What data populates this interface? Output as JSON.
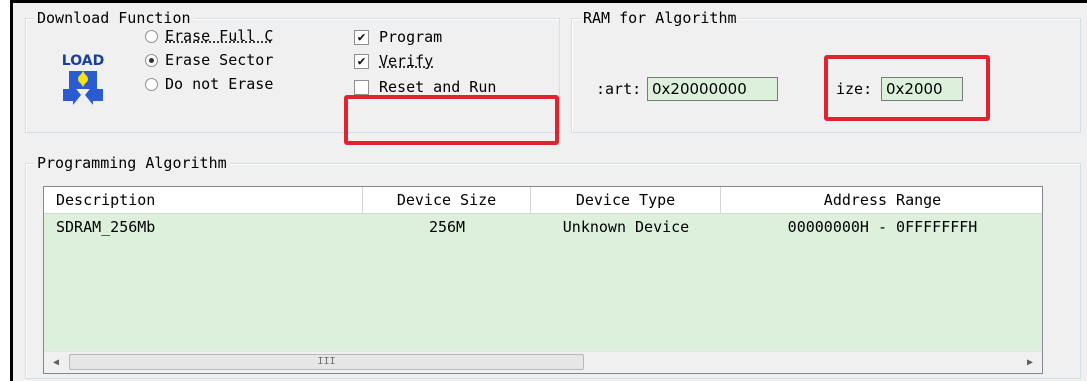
{
  "download_function": {
    "title": "Download Function",
    "logo_text": "LOAD",
    "erase_options": [
      {
        "label": "Erase Full C",
        "selected": false
      },
      {
        "label": "Erase Sector",
        "selected": true
      },
      {
        "label": "Do not Erase",
        "selected": false
      }
    ],
    "checkboxes": [
      {
        "label": "Program",
        "checked": true
      },
      {
        "label": "Verify",
        "checked": true
      },
      {
        "label": "Reset and Run",
        "checked": false
      }
    ]
  },
  "ram_for_algorithm": {
    "title": "RAM for Algorithm",
    "start_label": ":art:",
    "start_value": "0x20000000",
    "size_label": "ize:",
    "size_value": "0x2000"
  },
  "programming_algorithm": {
    "title": "Programming Algorithm",
    "columns": [
      "Description",
      "Device Size",
      "Device Type",
      "Address Range"
    ],
    "rows": [
      {
        "description": "SDRAM_256Mb",
        "device_size": "256M",
        "device_type": "Unknown Device",
        "address_range": "00000000H - 0FFFFFFFH"
      }
    ],
    "scroll_thumb_grip": "III"
  },
  "colors": {
    "highlight": "#e0232f",
    "field_background": "#dcf0dc",
    "window_background": "#f0f0f0"
  }
}
